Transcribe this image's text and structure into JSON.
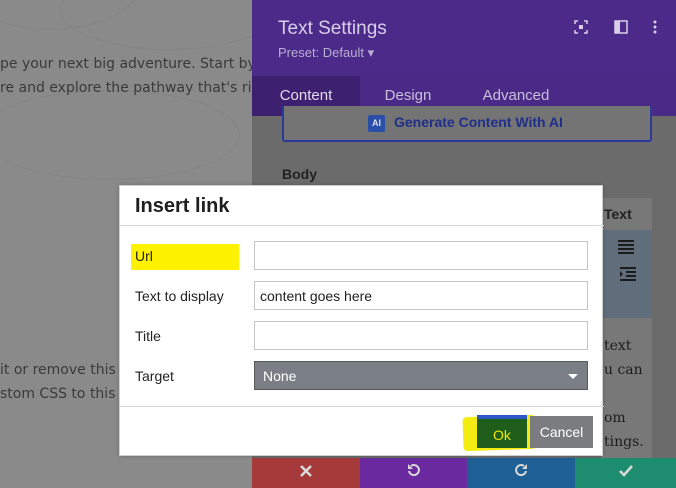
{
  "background": {
    "lines": [
      "pe your next big adventure. Start by co",
      "re and explore the pathway that's right",
      "it or remove this t",
      "stom CSS to this te"
    ]
  },
  "settings_panel": {
    "title": "Text Settings",
    "preset": "Preset: Default ▾",
    "tabs": [
      "Content",
      "Design",
      "Advanced"
    ],
    "active_tab": "Content",
    "generate_ai": {
      "badge": "AI",
      "label": "Generate Content With AI"
    },
    "body_label": "Body",
    "editor_snippets": [
      "Text",
      "text",
      "u can",
      "om",
      "tings."
    ],
    "header_icons": [
      "expand-icon",
      "columns-icon",
      "more-icon"
    ],
    "footer_icons": [
      "close-icon",
      "undo-icon",
      "redo-icon",
      "check-icon"
    ],
    "colors": {
      "header": "#4b2a8a",
      "red": "#a63a3a",
      "purple": "#6b2aa0",
      "blue": "#1e5f95",
      "green": "#1e8c6e"
    }
  },
  "dialog": {
    "title": "Insert link",
    "fields": {
      "url": {
        "label": "Url",
        "value": ""
      },
      "text": {
        "label": "Text to display",
        "value": "content goes here"
      },
      "title": {
        "label": "Title",
        "value": ""
      },
      "target": {
        "label": "Target",
        "selected": "None"
      }
    },
    "ok_label": "Ok",
    "cancel_label": "Cancel"
  }
}
